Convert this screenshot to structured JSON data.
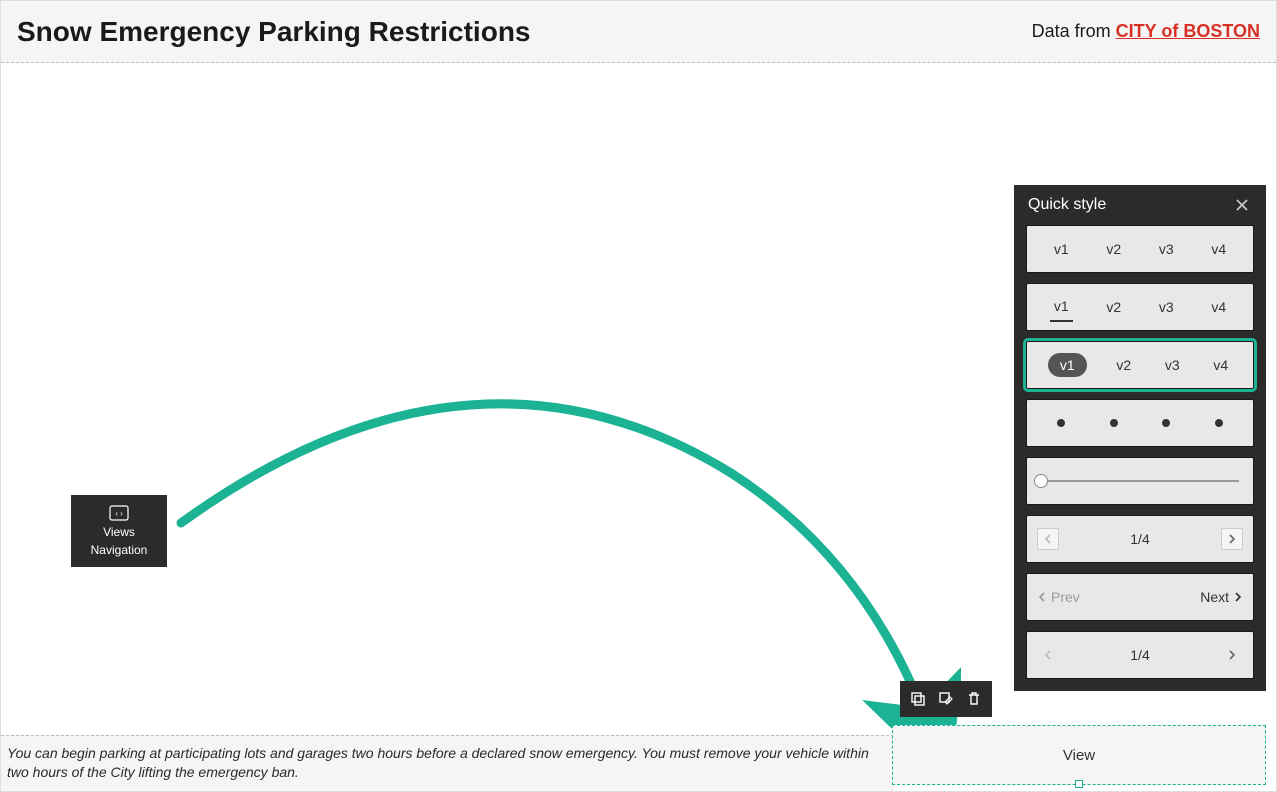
{
  "header": {
    "title": "Snow Emergency Parking Restrictions",
    "credit_prefix": "Data from ",
    "credit_link": "CITY of BOSTON"
  },
  "views_nav": {
    "line1": "Views",
    "line2": "Navigation"
  },
  "footer": {
    "text": "You can begin parking at participating lots and garages two hours before a declared snow emergency. You must remove your vehicle within two hours of the City lifting the emergency ban."
  },
  "quick_style": {
    "title": "Quick style",
    "rows": {
      "tabs_plain": [
        "v1",
        "v2",
        "v3",
        "v4"
      ],
      "tabs_underline": [
        "v1",
        "v2",
        "v3",
        "v4"
      ],
      "tabs_pill": [
        "v1",
        "v2",
        "v3",
        "v4"
      ],
      "pager1": "1/4",
      "prev_label": "Prev",
      "next_label": "Next",
      "pager2": "1/4"
    }
  },
  "view_widget": {
    "label": "View"
  },
  "colors": {
    "accent": "#1bb394",
    "link": "#d93025"
  }
}
